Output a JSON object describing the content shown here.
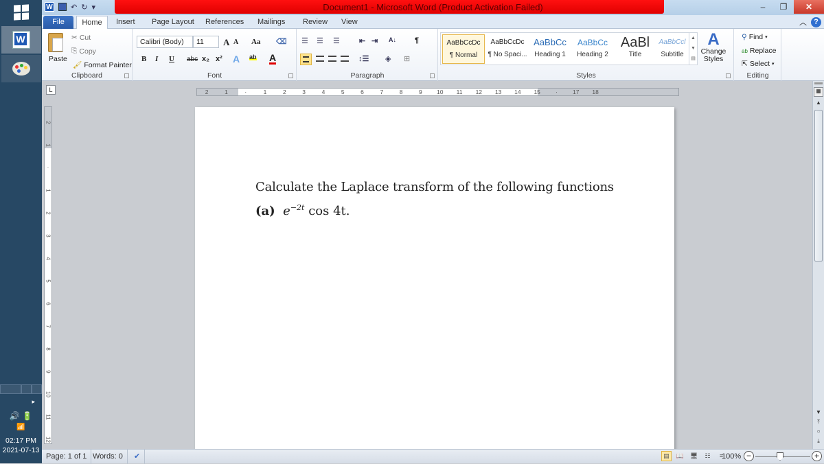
{
  "window": {
    "title": "Document1  -  Microsoft Word (Product Activation Failed)",
    "minimize_glyph": "–",
    "restore_glyph": "❐",
    "close_glyph": "✕"
  },
  "quick_access": {
    "word_icon": "W",
    "undo_glyph": "↶",
    "redo_glyph": "↻",
    "customize_glyph": "▾"
  },
  "taskbar": {
    "apps": [
      {
        "name": "Microsoft Word",
        "icon": "W"
      },
      {
        "name": "Paint",
        "icon": "palette"
      }
    ],
    "tray_arrow": "▸",
    "volume_glyph": "🔊",
    "battery_glyph": "🔋",
    "signal_glyph": "📶",
    "time": "02:17 PM",
    "date": "2021-07-13"
  },
  "tabs": [
    {
      "label": "File",
      "active": false
    },
    {
      "label": "Home",
      "active": true
    },
    {
      "label": "Insert",
      "active": false
    },
    {
      "label": "Page Layout",
      "active": false
    },
    {
      "label": "References",
      "active": false
    },
    {
      "label": "Mailings",
      "active": false
    },
    {
      "label": "Review",
      "active": false
    },
    {
      "label": "View",
      "active": false
    }
  ],
  "ribbon_controls": {
    "collapse_glyph": "︿",
    "help_glyph": "?"
  },
  "clipboard": {
    "label": "Clipboard",
    "paste": "Paste",
    "cut": "Cut",
    "copy": "Copy",
    "format_painter": "Format Painter"
  },
  "font": {
    "label": "Font",
    "font_name": "Calibri (Body)",
    "font_size": "11",
    "grow": "A",
    "shrink": "A",
    "change_case": "Aa",
    "bold": "B",
    "italic": "I",
    "underline": "U",
    "strikethrough": "abc",
    "subscript": "x₂",
    "superscript": "x²",
    "text_effects": "A",
    "highlight": "ab",
    "font_color": "A",
    "font_color_hex": "#e00000"
  },
  "paragraph": {
    "label": "Paragraph",
    "bullets": "☰",
    "numbering": "☰",
    "multilevel": "☰",
    "decrease_indent": "⇤",
    "increase_indent": "⇥",
    "sort": "A↓",
    "show_marks": "¶",
    "shading": "◈",
    "borders": "⊞"
  },
  "styles": {
    "label": "Styles",
    "items": [
      {
        "sample": "AaBbCcDc",
        "name": "¶ Normal",
        "selected": true
      },
      {
        "sample": "AaBbCcDc",
        "name": "¶ No Spaci...",
        "selected": false
      },
      {
        "sample": "AaBbCc",
        "name": "Heading 1",
        "selected": false
      },
      {
        "sample": "AaBbCc",
        "name": "Heading 2",
        "selected": false
      },
      {
        "sample": "AaBl",
        "name": "Title",
        "selected": false
      },
      {
        "sample": "AaBbCcl",
        "name": "Subtitle",
        "selected": false
      }
    ],
    "change_styles": "Change Styles"
  },
  "editing": {
    "label": "Editing",
    "find": "Find",
    "replace": "Replace",
    "select": "Select"
  },
  "ruler": {
    "tab_selector": "L",
    "horizontal": [
      "2",
      "1",
      "",
      "1",
      "2",
      "3",
      "4",
      "5",
      "6",
      "7",
      "8",
      "9",
      "10",
      "11",
      "12",
      "13",
      "14",
      "15",
      "",
      "17",
      "18"
    ],
    "vertical": [
      "2",
      "1",
      "",
      "1",
      "2",
      "3",
      "4",
      "5",
      "6",
      "7",
      "8",
      "9",
      "10",
      "11",
      "12"
    ]
  },
  "document": {
    "line1": "Calculate the Laplace transform of the following functions",
    "item_label": "(a)",
    "item_base": "e",
    "item_exponent": "−2t",
    "item_rest": "cos 4t."
  },
  "status": {
    "page": "Page: 1 of 1",
    "words": "Words: 0",
    "proofing_glyph": "✔",
    "zoom": "100%",
    "zoom_level_percent": 100
  }
}
